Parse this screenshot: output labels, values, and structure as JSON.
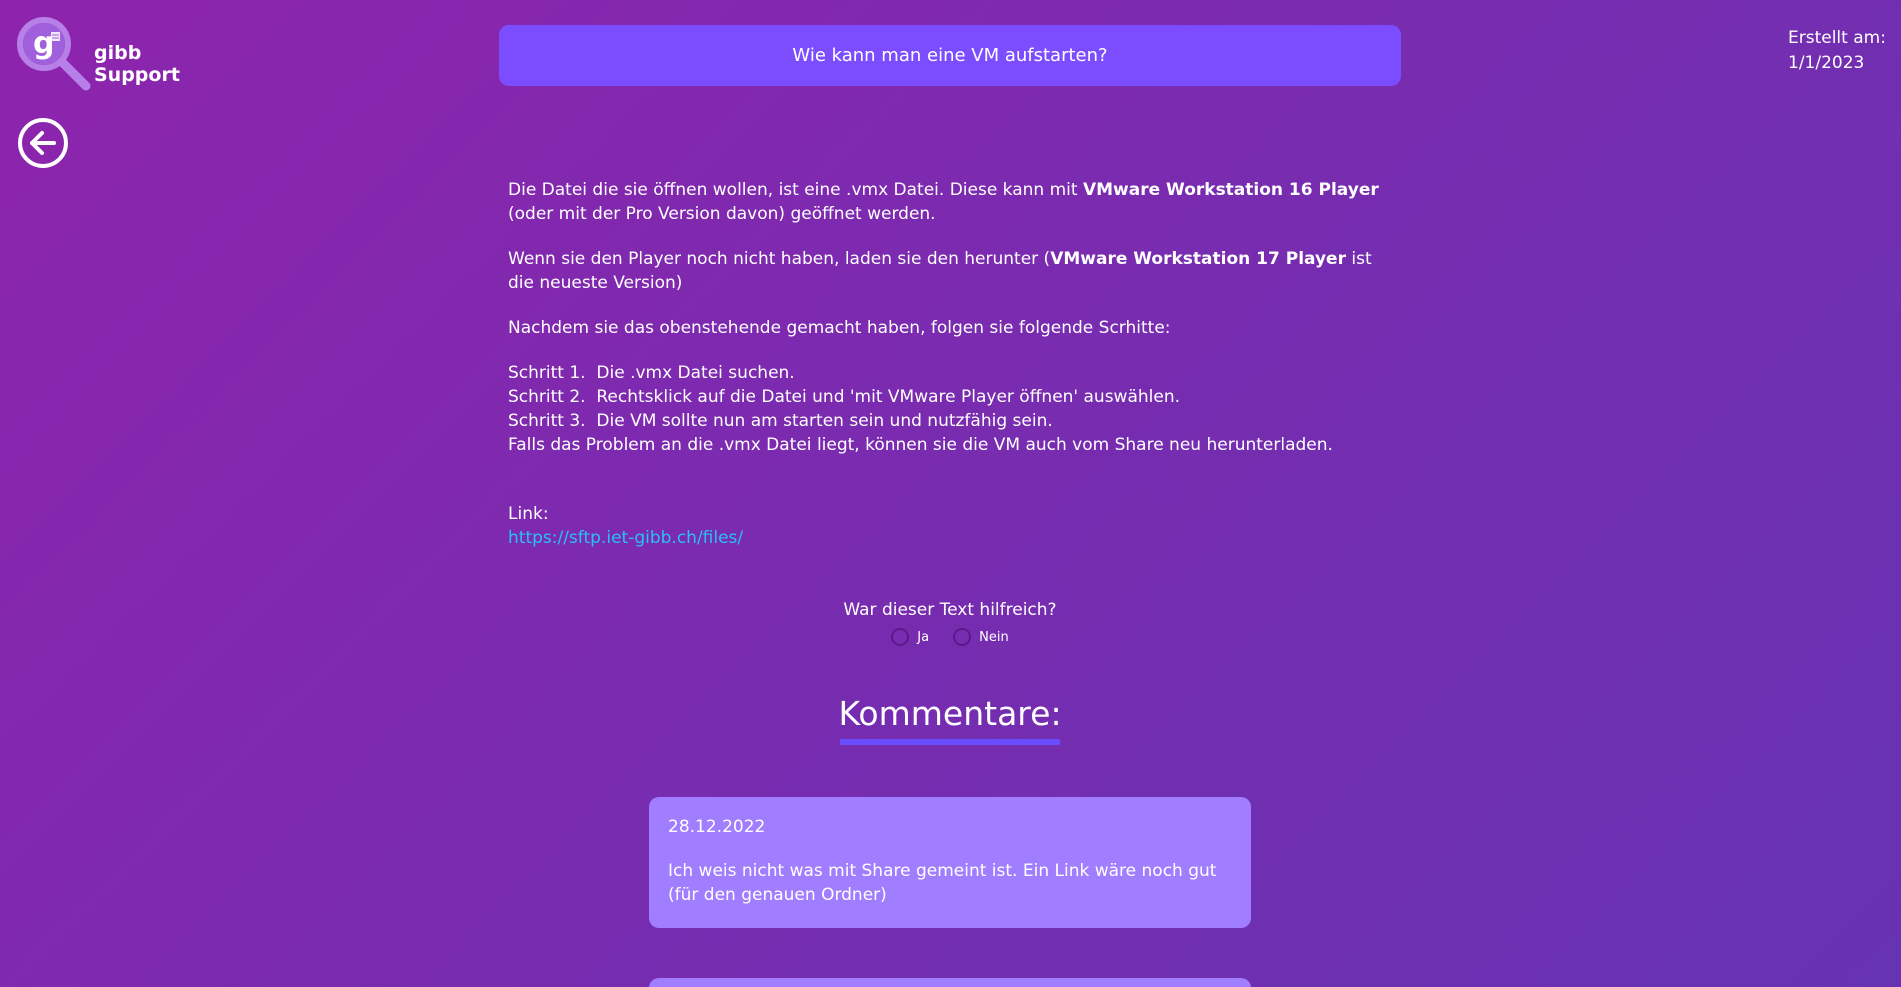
{
  "header": {
    "brand": "gibb Support",
    "logo_letter": "g",
    "question": "Wie kann man eine VM aufstarten?",
    "created_label": "Erstellt am:",
    "created_date": "1/1/2023"
  },
  "article": {
    "p1_a": "Die Datei die sie öffnen wollen, ist eine .vmx Datei. Diese kann mit ",
    "p1_bold": "VMware Workstation 16 Player",
    "p1_b": " (oder mit der Pro Version davon) geöffnet werden.",
    "p2_a": "Wenn sie den Player noch nicht haben, laden sie den herunter (",
    "p2_bold": "VMware Workstation 17 Player",
    "p2_b": " ist die neueste Version)",
    "p3": "Nachdem sie das obenstehende gemacht haben, folgen sie folgende Scrhitte:",
    "steps": [
      "Schritt 1.  Die .vmx Datei suchen.",
      "Schritt 2.  Rechtsklick auf die Datei und 'mit VMware Player öffnen' auswählen.",
      "Schritt 3.  Die VM sollte nun am starten sein und nutzfähig sein."
    ],
    "note": "Falls das Problem an die .vmx Datei liegt, können sie die VM auch vom Share neu herunterladen.",
    "link_label": "Link:",
    "link_url": "https://sftp.iet-gibb.ch/files/"
  },
  "feedback": {
    "question": "War dieser Text hilfreich?",
    "yes": "Ja",
    "no": "Nein"
  },
  "comments": {
    "heading": "Kommentare:",
    "items": [
      {
        "date": "28.12.2022",
        "text": "Ich weis nicht was mit Share gemeint ist. Ein Link wäre noch gut (für den genauen Ordner)"
      }
    ]
  },
  "colors": {
    "accent": "#7c4dff",
    "comment_bg": "#a17dff",
    "link": "#27c1f5"
  }
}
